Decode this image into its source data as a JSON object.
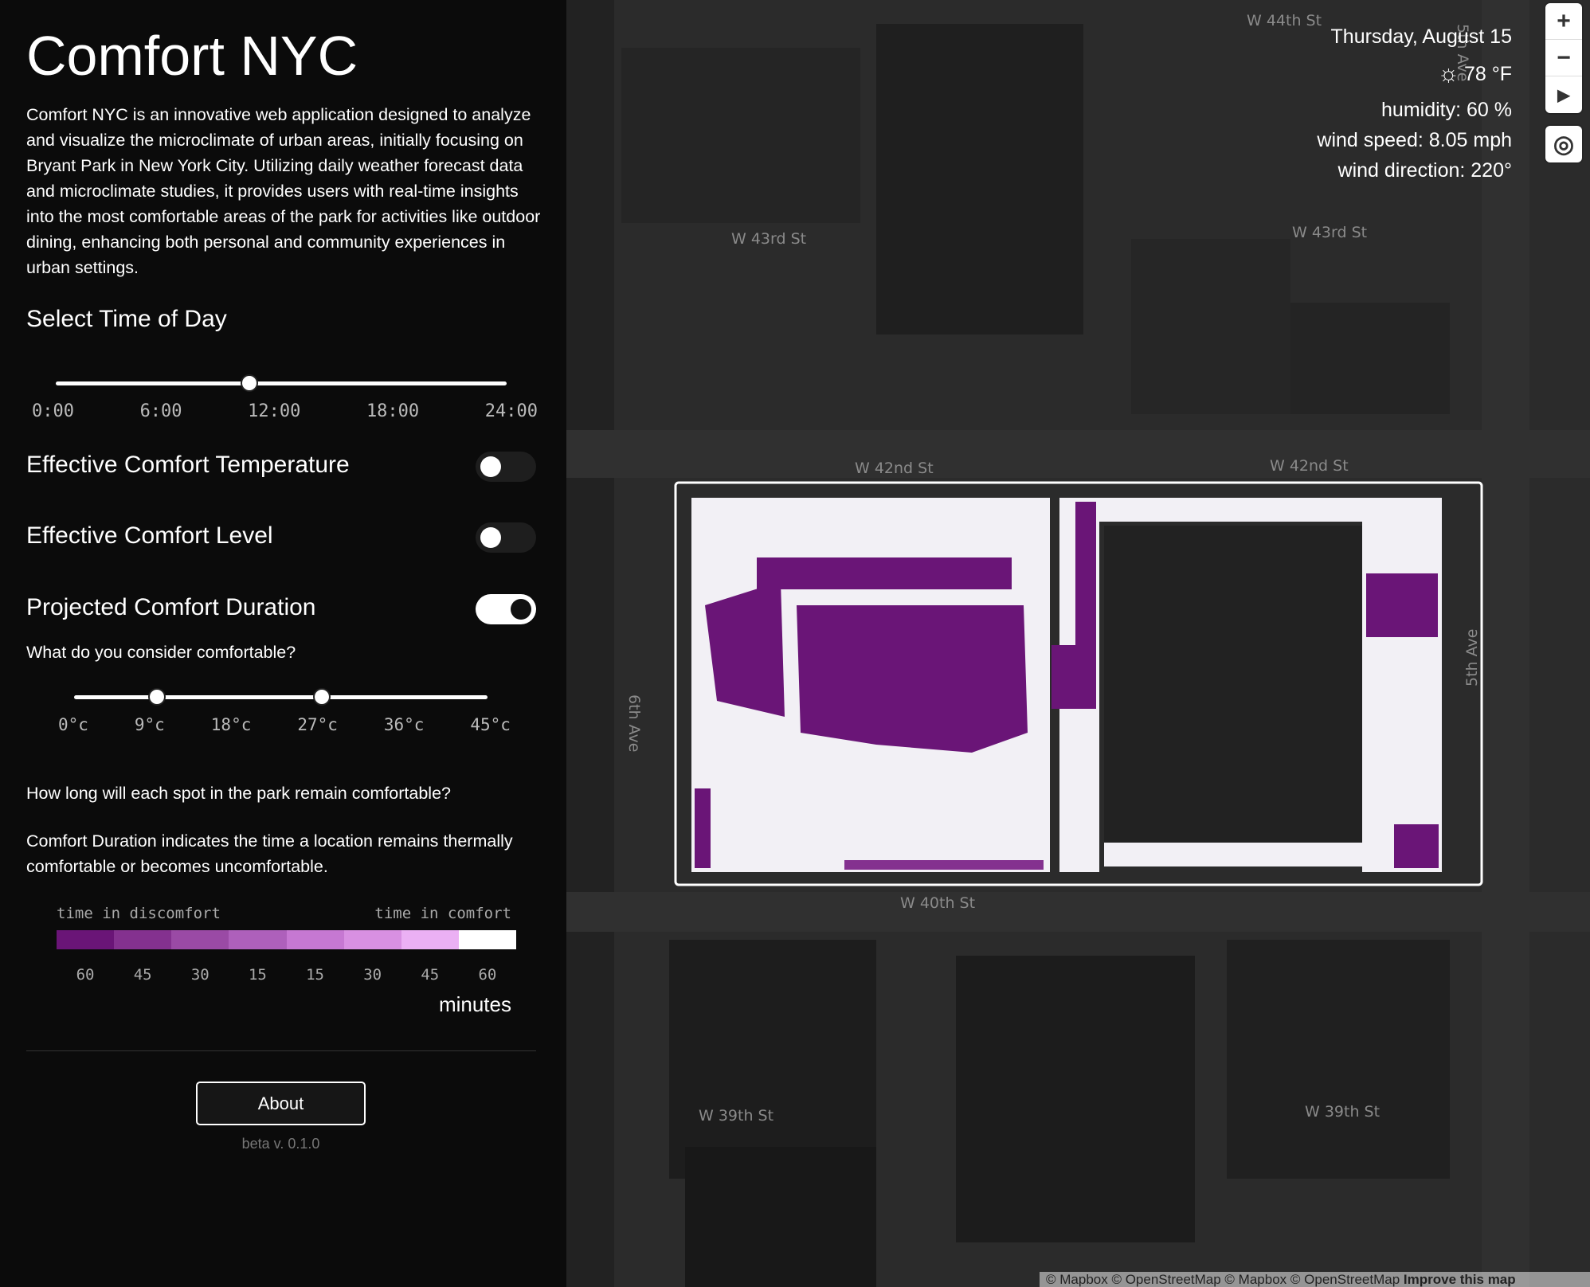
{
  "app": {
    "title": "Comfort NYC",
    "description": "Comfort NYC is an innovative web application designed to analyze and visualize the microclimate of urban areas, initially focusing on Bryant Park in New York City. Utilizing daily weather forecast data and microclimate studies, it provides users with real-time insights into the most comfortable areas of the park for activities like outdoor dining, enhancing both personal and community experiences in urban settings."
  },
  "time_slider": {
    "label": "Select Time of Day",
    "value_fraction": 0.43,
    "ticks": [
      "0:00",
      "6:00",
      "12:00",
      "18:00",
      "24:00"
    ]
  },
  "layers": [
    {
      "label": "Effective Comfort Temperature",
      "on": false
    },
    {
      "label": "Effective Comfort Level",
      "on": false
    },
    {
      "label": "Projected Comfort Duration",
      "on": true
    }
  ],
  "comfort": {
    "question": "What do you consider comfortable?",
    "range_min_c": 9,
    "range_max_c": 27,
    "ticks": [
      "0°c",
      "9°c",
      "18°c",
      "27°c",
      "36°c",
      "45°c"
    ]
  },
  "duration": {
    "question": "How long will each spot in the park remain comfortable?",
    "explanation": "Comfort Duration indicates the time a location remains thermally comfortable or becomes uncomfortable."
  },
  "legend": {
    "left_label": "time in discomfort",
    "right_label": "time in comfort",
    "colors": [
      "#6a1577",
      "#84318f",
      "#9a4aa5",
      "#ae60bb",
      "#c678d2",
      "#d890e2",
      "#ebb0f4",
      "#ffffff"
    ],
    "ticks": [
      "60",
      "45",
      "30",
      "15",
      "15",
      "30",
      "45",
      "60"
    ],
    "unit": "minutes"
  },
  "footer": {
    "about": "About",
    "version": "beta v. 0.1.0"
  },
  "weather": {
    "date": "Thursday, August 15",
    "icon": "sun-icon",
    "temp": "78 °F",
    "humidity": "humidity: 60 %",
    "wind_speed": "wind speed: 8.05 mph",
    "wind_direction": "wind direction: 220°"
  },
  "map": {
    "streets": [
      "W 44th St",
      "W 43rd St",
      "W 43rd St",
      "W 42nd St",
      "W 42nd St",
      "W 40th St",
      "W 39th St",
      "W 39th St",
      "6th Ave",
      "5th Ave",
      "5th Ave"
    ],
    "attribution": "© Mapbox © OpenStreetMap © Mapbox © OpenStreetMap",
    "improve": "Improve this map"
  },
  "controls": {
    "zoom_in": "+",
    "zoom_out": "−"
  }
}
